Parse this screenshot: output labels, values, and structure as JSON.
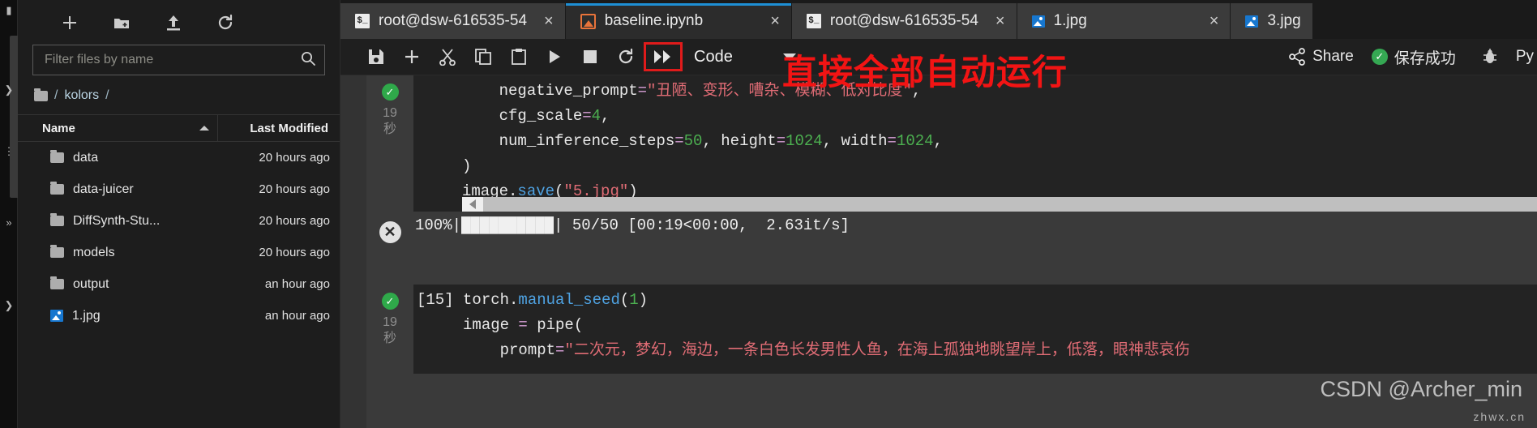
{
  "filebrowser": {
    "toolbar": [
      {
        "name": "new-launcher-button",
        "icon": "plus-icon",
        "label": "+"
      },
      {
        "name": "new-folder-button",
        "icon": "new-folder-icon",
        "label": ""
      },
      {
        "name": "upload-button",
        "icon": "upload-icon",
        "label": ""
      },
      {
        "name": "refresh-button",
        "icon": "refresh-icon",
        "label": ""
      }
    ],
    "filter_placeholder": "Filter files by name",
    "filter_value": "",
    "breadcrumb_sep_left": "/",
    "breadcrumb_name": "kolors",
    "breadcrumb_sep_right": "/",
    "columns": {
      "name": "Name",
      "last_modified": "Last Modified"
    },
    "rows": [
      {
        "icon": "folder-icon",
        "name": "data",
        "modified": "20 hours ago"
      },
      {
        "icon": "folder-icon",
        "name": "data-juicer",
        "modified": "20 hours ago"
      },
      {
        "icon": "folder-icon",
        "name": "DiffSynth-Stu...",
        "modified": "20 hours ago"
      },
      {
        "icon": "folder-icon",
        "name": "models",
        "modified": "20 hours ago"
      },
      {
        "icon": "folder-icon",
        "name": "output",
        "modified": "an hour ago"
      },
      {
        "icon": "image-icon",
        "name": "1.jpg",
        "modified": "an hour ago"
      }
    ]
  },
  "tabs": [
    {
      "icon": "terminal-icon",
      "label": "root@dsw-616535-54",
      "close": "×",
      "active": false
    },
    {
      "icon": "notebook-icon",
      "label": "baseline.ipynb",
      "close": "×",
      "active": true
    },
    {
      "icon": "terminal-icon",
      "label": "root@dsw-616535-54",
      "close": "×",
      "active": false
    },
    {
      "icon": "image-icon",
      "label": "1.jpg",
      "close": "×",
      "active": false
    },
    {
      "icon": "image-icon",
      "label": "3.jpg",
      "close": "",
      "active": false
    }
  ],
  "nbtoolbar": {
    "buttons": [
      {
        "name": "save-button",
        "icon": "save-icon"
      },
      {
        "name": "insert-cell-button",
        "icon": "plus-icon"
      },
      {
        "name": "cut-button",
        "icon": "scissors-icon"
      },
      {
        "name": "copy-button",
        "icon": "copy-icon"
      },
      {
        "name": "paste-button",
        "icon": "clipboard-icon"
      },
      {
        "name": "run-button",
        "icon": "play-icon"
      },
      {
        "name": "stop-button",
        "icon": "stop-icon"
      },
      {
        "name": "restart-button",
        "icon": "restart-icon"
      },
      {
        "name": "restart-run-all-button",
        "icon": "fast-forward-icon",
        "highlighted": true
      }
    ],
    "celltype": "Code",
    "share_label": "Share",
    "save_status": "保存成功",
    "save_status_icon": "check-circle-icon",
    "debug_icon": "bug-icon",
    "kernel_label": "Py",
    "highlight_color": "#e01b1b"
  },
  "annotation": {
    "text": "直接全部自动运行",
    "color": "#f21414"
  },
  "cells": [
    {
      "status_icon": "check-circle-icon",
      "exec_time_value": "19",
      "exec_time_unit": "秒",
      "code_lines": [
        [
          {
            "t": "    negative_prompt",
            "c": "plain"
          },
          {
            "t": "=",
            "c": "op"
          },
          {
            "t": "\"丑陋、变形、嘶杂、模糊、低对比度\"",
            "c": "str"
          },
          {
            "t": ",",
            "c": "plain"
          }
        ],
        [
          {
            "t": "    cfg_scale",
            "c": "plain"
          },
          {
            "t": "=",
            "c": "op"
          },
          {
            "t": "4",
            "c": "num"
          },
          {
            "t": ",",
            "c": "plain"
          }
        ],
        [
          {
            "t": "    num_inference_steps",
            "c": "plain"
          },
          {
            "t": "=",
            "c": "op"
          },
          {
            "t": "50",
            "c": "num"
          },
          {
            "t": ", height",
            "c": "plain"
          },
          {
            "t": "=",
            "c": "op"
          },
          {
            "t": "1024",
            "c": "num"
          },
          {
            "t": ", width",
            "c": "plain"
          },
          {
            "t": "=",
            "c": "op"
          },
          {
            "t": "1024",
            "c": "num"
          },
          {
            "t": ",",
            "c": "plain"
          }
        ],
        [
          {
            "t": ")",
            "c": "plain"
          }
        ],
        [
          {
            "t": "image.",
            "c": "plain"
          },
          {
            "t": "save",
            "c": "fn"
          },
          {
            "t": "(",
            "c": "plain"
          },
          {
            "t": "\"5.jpg\"",
            "c": "str"
          },
          {
            "t": ")",
            "c": "plain"
          }
        ]
      ]
    }
  ],
  "output": {
    "status_icon": "error-x-icon",
    "progress_percent": "100%",
    "progress_text": "100%|██████████| 50/50 [00:19<00:00,  2.63it/s]",
    "counter": "50/50",
    "elapsed": "00:19",
    "remaining": "00:00",
    "rate": "2.63it/s"
  },
  "cell2": {
    "status_icon": "check-circle-icon",
    "exec_time_value": "19",
    "exec_time_unit": "秒",
    "prompt_label": "[15]",
    "line1": [
      {
        "t": "torch.",
        "c": "plain"
      },
      {
        "t": "manual_seed",
        "c": "fn"
      },
      {
        "t": "(",
        "c": "plain"
      },
      {
        "t": "1",
        "c": "num"
      },
      {
        "t": ")",
        "c": "plain"
      }
    ],
    "line2": [
      {
        "t": "image ",
        "c": "plain"
      },
      {
        "t": "=",
        "c": "op"
      },
      {
        "t": " pipe(",
        "c": "plain"
      }
    ],
    "line3": [
      {
        "t": "    prompt",
        "c": "plain"
      },
      {
        "t": "=",
        "c": "op"
      },
      {
        "t": "\"二次元，梦幻，海边，一条白色长发男性人鱼，在海上孤独地眺望岸上，低落，眼神悲哀伤",
        "c": "str"
      }
    ]
  },
  "watermark": {
    "text": "CSDN @Archer_min",
    "text2": "zhwx.cn"
  }
}
